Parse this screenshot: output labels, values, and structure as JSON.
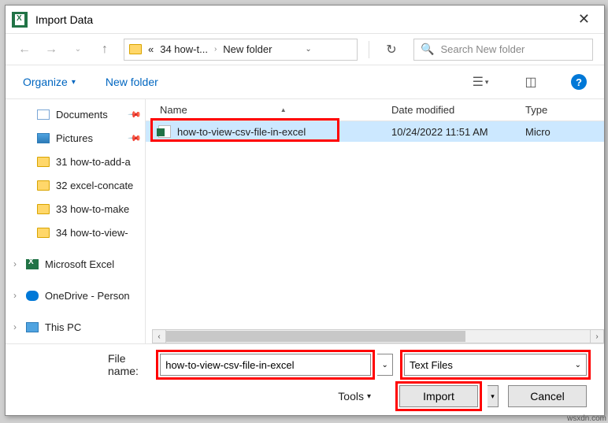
{
  "window": {
    "title": "Import Data"
  },
  "nav": {
    "crumb_prefix": "«",
    "crumb1": "34 how-t...",
    "crumb2": "New folder",
    "search_placeholder": "Search New folder"
  },
  "toolbar": {
    "organize": "Organize",
    "newfolder": "New folder"
  },
  "sidebar": {
    "items": [
      {
        "label": "Documents",
        "pin": true
      },
      {
        "label": "Pictures",
        "pin": true
      },
      {
        "label": "31 how-to-add-a"
      },
      {
        "label": "32 excel-concate"
      },
      {
        "label": "33 how-to-make"
      },
      {
        "label": "34 how-to-view-"
      },
      {
        "label": "Microsoft Excel"
      },
      {
        "label": "OneDrive - Person"
      },
      {
        "label": "This PC"
      }
    ]
  },
  "list": {
    "headers": {
      "name": "Name",
      "date": "Date modified",
      "type": "Type"
    },
    "rows": [
      {
        "name": "how-to-view-csv-file-in-excel",
        "date": "10/24/2022 11:51 AM",
        "type": "Micro"
      }
    ]
  },
  "bottom": {
    "filename_label": "File name:",
    "filename_value": "how-to-view-csv-file-in-excel",
    "filter": "Text Files",
    "tools": "Tools",
    "import": "Import",
    "cancel": "Cancel"
  },
  "watermark": "wsxdn.com"
}
